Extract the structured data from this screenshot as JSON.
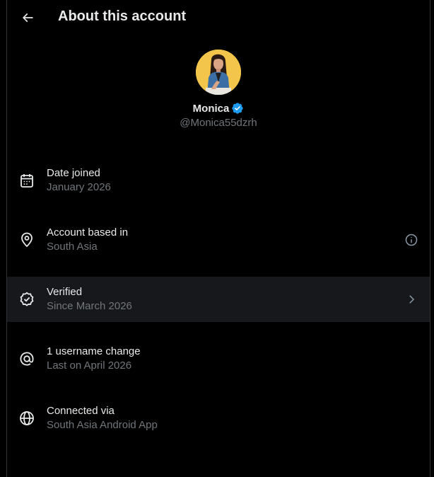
{
  "header": {
    "back_icon": "arrow-left-icon",
    "title": "About this account"
  },
  "profile": {
    "avatar_icon": "profile-photo",
    "avatar_bg": "#f3c64b",
    "display_name": "Monica",
    "verified_icon": "verified-badge-icon",
    "verified_color": "#1d9bf0",
    "handle": "@Monica55dzrh"
  },
  "details": [
    {
      "icon": "calendar-icon",
      "title": "Date joined",
      "value": "January 2026"
    },
    {
      "icon": "location-pin-icon",
      "title": "Account based in",
      "value": "South Asia",
      "action_icon": "info-icon"
    },
    {
      "icon": "verified-check-icon",
      "title": "Verified",
      "value": "Since March 2026",
      "action_icon": "chevron-right-icon"
    },
    {
      "icon": "at-sign-icon",
      "title": "1 username change",
      "value": "Last on April 2026"
    },
    {
      "icon": "globe-icon",
      "title": "Connected via",
      "value": "South Asia Android App"
    }
  ],
  "colors": {
    "background": "#000000",
    "primary_text": "#e7e9ea",
    "secondary_text": "#71767b",
    "highlight_row": "#16181c",
    "border": "#2f3336"
  }
}
